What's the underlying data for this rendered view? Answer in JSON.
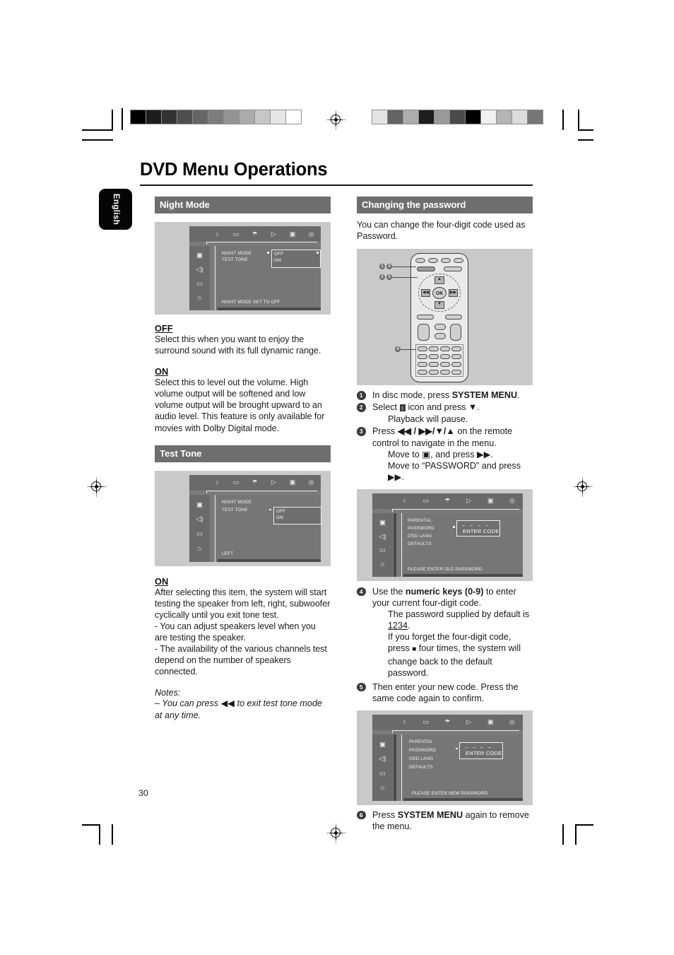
{
  "page": {
    "title": "DVD Menu Operations",
    "language_tab": "English",
    "page_number": "30"
  },
  "print_marks": {
    "left_wedge": [
      "#000000",
      "#1c1c1c",
      "#333333",
      "#4e4e4e",
      "#666666",
      "#7d7d7d",
      "#949494",
      "#ababab",
      "#c6c6c6",
      "#e6e6e6",
      "#ffffff"
    ],
    "right_wedge": [
      "#e3e3e3",
      "#646464",
      "#adadad",
      "#1e1e1e",
      "#9a9a9a",
      "#4a4a4a",
      "#000000",
      "#f0f0f0",
      "#b4b4b4",
      "#dcdcdc",
      "#767676"
    ]
  },
  "left_column": {
    "night_mode": {
      "heading": "Night Mode",
      "osd": {
        "top_icons": [
          "↕",
          "▭",
          "☂",
          "▷",
          "▣",
          "◎"
        ],
        "side_icons": [
          "▣",
          "◁)",
          "▭",
          "⌂"
        ],
        "menu_items": [
          "NIGHT MODE",
          "TEST TONE"
        ],
        "options": [
          "OFF",
          "ON"
        ],
        "status": "NIGHT MODE SET TO OFF"
      },
      "off_heading": "OFF",
      "off_text": "Select this when you want to enjoy the surround sound with its full dynamic range.",
      "on_heading": "ON",
      "on_text": "Select this to level out the volume. High volume output will be softened and low volume output will be brought upward to an audio level. This feature is only available for movies with Dolby Digital mode."
    },
    "test_tone": {
      "heading": "Test Tone",
      "osd": {
        "top_icons": [
          "↕",
          "▭",
          "☂",
          "▷",
          "▣",
          "◎"
        ],
        "side_icons": [
          "▣",
          "◁)",
          "▭",
          "⌂"
        ],
        "menu_items": [
          "NIGHT MODE",
          "TEST TONE"
        ],
        "options": [
          "OFF",
          "ON"
        ],
        "status": "LEFT"
      },
      "on_heading": "ON",
      "on_text": "After selecting this item, the system will start testing the speaker from left,  right,  subwoofer cyclically until you exit tone test.",
      "bullet_1": "- You can adjust speakers level when you are testing the speaker.",
      "bullet_2": "- The availability of the various channels test depend on the number of speakers connected.",
      "notes_label": "Notes:",
      "notes_text_pre": "–  You can press ",
      "notes_icon": "◀◀",
      "notes_text_post": " to exit test tone mode at any time."
    }
  },
  "right_column": {
    "heading": "Changing the password",
    "intro": "You can change the four-digit code used as Password.",
    "remote": {
      "ok_label": "OK",
      "callouts": [
        "1",
        "3",
        "2",
        "3",
        "4"
      ]
    },
    "steps": [
      {
        "num": "1",
        "text_pre": "In disc mode, press ",
        "bold": "SYSTEM MENU",
        "text_post": "."
      },
      {
        "num": "2",
        "text_pre": "Select ",
        "icon": "↕",
        "text_post": " icon and press ▼.",
        "sub": [
          "Playback will pause."
        ]
      },
      {
        "num": "3",
        "text_pre": "Press ",
        "bold": "◀◀ / ▶▶/▼/▲",
        "text_post": " on the remote control to navigate in the menu.",
        "sub": [
          "Move to ▣, and press ▶▶.",
          "Move to “PASSWORD” and press ▶▶."
        ]
      },
      {
        "num": "4",
        "text_pre": "Use the ",
        "bold": "numeric keys (0-9)",
        "text_post": " to enter your current four-digit code.",
        "sub_rich": [
          {
            "pre": "The password supplied by default is ",
            "underline": "1234",
            "post": "."
          },
          {
            "pre": "If you forget the four-digit code, press ",
            "square": "■",
            "post": " four times, the system will change back to the default password."
          }
        ]
      },
      {
        "num": "5",
        "text_pre": "Then enter your new code. Press the same code again to confirm.",
        "bold": "",
        "text_post": ""
      },
      {
        "num": "6",
        "text_pre": "Press ",
        "bold": "SYSTEM MENU",
        "text_post": " again to remove the menu."
      }
    ],
    "osd_old": {
      "top_icons": [
        "↕",
        "▭",
        "☂",
        "▷",
        "▣",
        "◎"
      ],
      "side_icons": [
        "▣",
        "◁)",
        "▭",
        "⌂"
      ],
      "menu_items": [
        "PARENTAL",
        "PASSWORD",
        "OSD LANG",
        "DEFAULTS"
      ],
      "dashes": "–  –  –  –",
      "enter_code": "ENTER CODE",
      "status": "PLEASE ENTER OLD PASSWORD"
    },
    "osd_new": {
      "top_icons": [
        "↕",
        "▭",
        "☂",
        "▷",
        "▣",
        "◎"
      ],
      "side_icons": [
        "▣",
        "◁)",
        "▭",
        "⌂"
      ],
      "menu_items": [
        "PARENTAL",
        "PASSWORD",
        "OSD LANG",
        "DEFAULTS"
      ],
      "dashes": "–  –  –  –",
      "enter_code": "ENTER CODE",
      "status": "PLEASE ENTER NEW PASSWORD"
    }
  }
}
